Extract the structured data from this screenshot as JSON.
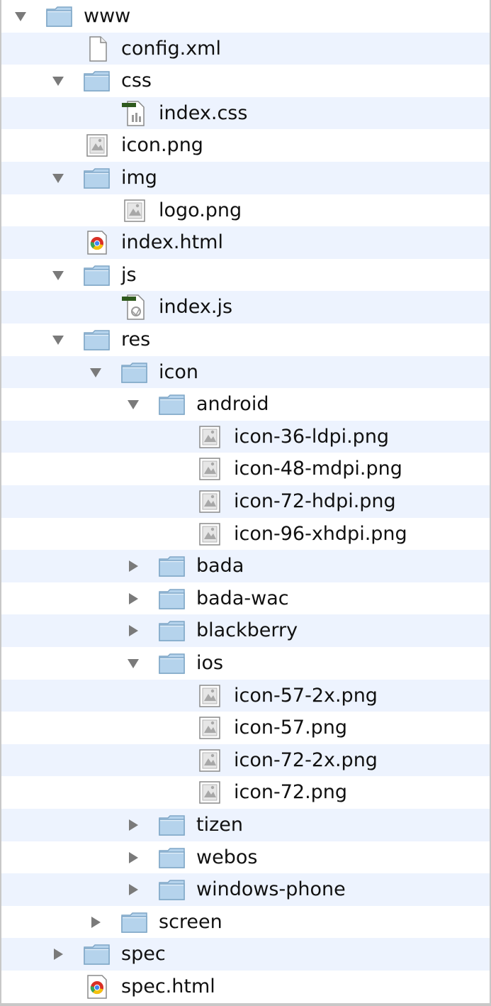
{
  "tree": [
    {
      "label": "www",
      "type": "folder",
      "expanded": true,
      "depth": 0
    },
    {
      "label": "config.xml",
      "type": "blank-file",
      "depth": 1
    },
    {
      "label": "css",
      "type": "folder",
      "expanded": true,
      "depth": 1
    },
    {
      "label": "index.css",
      "type": "css-file",
      "depth": 2
    },
    {
      "label": "icon.png",
      "type": "image-file",
      "depth": 1
    },
    {
      "label": "img",
      "type": "folder",
      "expanded": true,
      "depth": 1
    },
    {
      "label": "logo.png",
      "type": "image-file",
      "depth": 2
    },
    {
      "label": "index.html",
      "type": "html-file",
      "depth": 1
    },
    {
      "label": "js",
      "type": "folder",
      "expanded": true,
      "depth": 1
    },
    {
      "label": "index.js",
      "type": "js-file",
      "depth": 2
    },
    {
      "label": "res",
      "type": "folder",
      "expanded": true,
      "depth": 1
    },
    {
      "label": "icon",
      "type": "folder",
      "expanded": true,
      "depth": 2
    },
    {
      "label": "android",
      "type": "folder",
      "expanded": true,
      "depth": 3
    },
    {
      "label": "icon-36-ldpi.png",
      "type": "image-file",
      "depth": 4
    },
    {
      "label": "icon-48-mdpi.png",
      "type": "image-file",
      "depth": 4
    },
    {
      "label": "icon-72-hdpi.png",
      "type": "image-file",
      "depth": 4
    },
    {
      "label": "icon-96-xhdpi.png",
      "type": "image-file",
      "depth": 4
    },
    {
      "label": "bada",
      "type": "folder",
      "expanded": false,
      "depth": 3
    },
    {
      "label": "bada-wac",
      "type": "folder",
      "expanded": false,
      "depth": 3
    },
    {
      "label": "blackberry",
      "type": "folder",
      "expanded": false,
      "depth": 3
    },
    {
      "label": "ios",
      "type": "folder",
      "expanded": true,
      "depth": 3
    },
    {
      "label": "icon-57-2x.png",
      "type": "image-file",
      "depth": 4
    },
    {
      "label": "icon-57.png",
      "type": "image-file",
      "depth": 4
    },
    {
      "label": "icon-72-2x.png",
      "type": "image-file",
      "depth": 4
    },
    {
      "label": "icon-72.png",
      "type": "image-file",
      "depth": 4
    },
    {
      "label": "tizen",
      "type": "folder",
      "expanded": false,
      "depth": 3
    },
    {
      "label": "webos",
      "type": "folder",
      "expanded": false,
      "depth": 3
    },
    {
      "label": "windows-phone",
      "type": "folder",
      "expanded": false,
      "depth": 3
    },
    {
      "label": "screen",
      "type": "folder",
      "expanded": false,
      "depth": 2
    },
    {
      "label": "spec",
      "type": "folder",
      "expanded": false,
      "depth": 1
    },
    {
      "label": "spec.html",
      "type": "html-file",
      "depth": 1
    }
  ],
  "colors": {
    "stripe": "#edf3fe",
    "folder": "#b5d3ec",
    "folder_edge": "#7fa6c6",
    "disclosure": "#7a7a7a"
  }
}
